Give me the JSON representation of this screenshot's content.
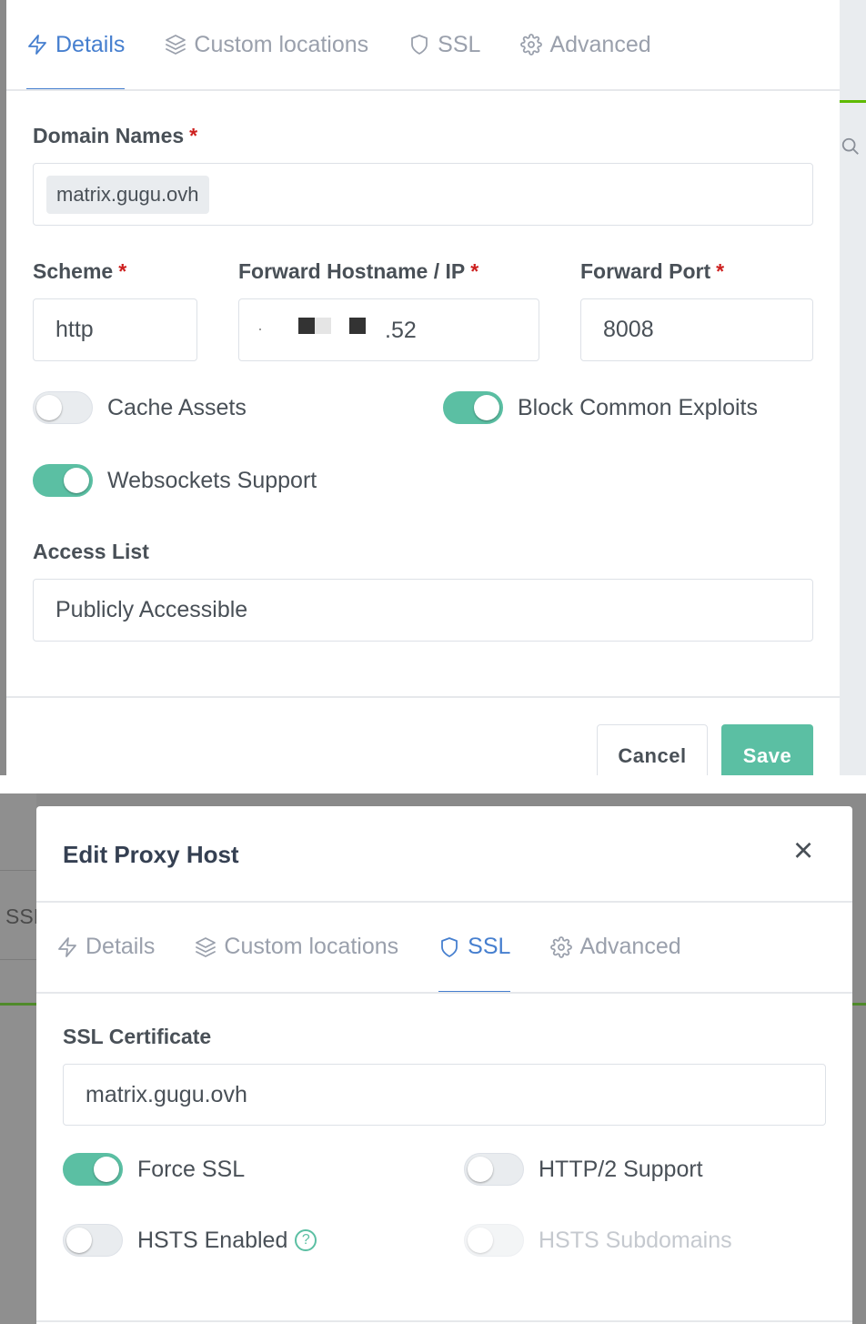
{
  "panel1": {
    "tabs": [
      {
        "label": "Details",
        "icon": "bolt-icon",
        "active": true
      },
      {
        "label": "Custom locations",
        "icon": "layers-icon",
        "active": false
      },
      {
        "label": "SSL",
        "icon": "shield-icon",
        "active": false
      },
      {
        "label": "Advanced",
        "icon": "gear-icon",
        "active": false
      }
    ],
    "domain_names": {
      "label": "Domain Names",
      "tag": "matrix.gugu.ovh"
    },
    "scheme": {
      "label": "Scheme",
      "value": "http"
    },
    "forward_host": {
      "label": "Forward Hostname / IP",
      "value_suffix": ".52"
    },
    "forward_port": {
      "label": "Forward Port",
      "value": "8008"
    },
    "required_mark": "*",
    "cache_assets": {
      "label": "Cache Assets",
      "on": false
    },
    "block_exploits": {
      "label": "Block Common Exploits",
      "on": true
    },
    "websockets": {
      "label": "Websockets Support",
      "on": true
    },
    "access_list": {
      "label": "Access List",
      "value": "Publicly Accessible"
    },
    "buttons": {
      "cancel": "Cancel",
      "save": "Save"
    }
  },
  "panel2": {
    "title": "Edit Proxy Host",
    "close_glyph": "×",
    "background_text": "SSI",
    "tabs": [
      {
        "label": "Details",
        "icon": "bolt-icon",
        "active": false
      },
      {
        "label": "Custom locations",
        "icon": "layers-icon",
        "active": false
      },
      {
        "label": "SSL",
        "icon": "shield-icon",
        "active": true
      },
      {
        "label": "Advanced",
        "icon": "gear-icon",
        "active": false
      }
    ],
    "ssl_certificate": {
      "label": "SSL Certificate",
      "value": "matrix.gugu.ovh"
    },
    "force_ssl": {
      "label": "Force SSL",
      "on": true
    },
    "http2": {
      "label": "HTTP/2 Support",
      "on": false
    },
    "hsts": {
      "label": "HSTS Enabled",
      "on": false,
      "help": "?"
    },
    "hsts_subdomains": {
      "label": "HSTS Subdomains",
      "on": false,
      "disabled": true
    }
  },
  "colors": {
    "accent": "#467fcf",
    "toggle_on": "#5bbfa3",
    "required": "#cd201f",
    "save_button": "#5bbfa3"
  }
}
